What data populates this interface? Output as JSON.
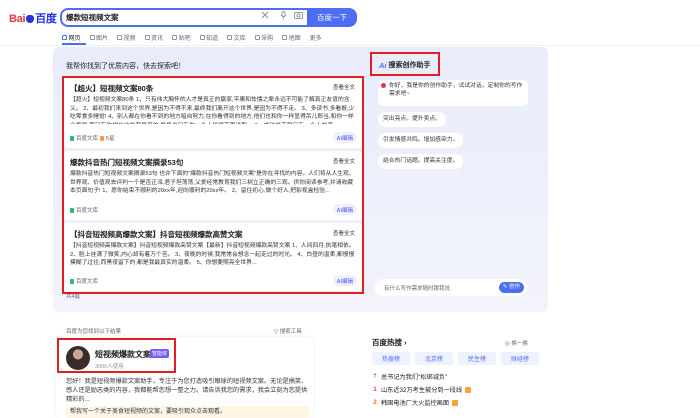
{
  "header": {
    "logo_left": "Bai",
    "logo_right": "百度",
    "search_value": "爆款短视频文案",
    "search_button": "百度一下"
  },
  "tabs": [
    {
      "label": "网页",
      "active": true
    },
    {
      "label": "图片",
      "active": false
    },
    {
      "label": "视频",
      "active": false
    },
    {
      "label": "资讯",
      "active": false
    },
    {
      "label": "贴吧",
      "active": false
    },
    {
      "label": "知道",
      "active": false
    },
    {
      "label": "文库",
      "active": false
    },
    {
      "label": "采购",
      "active": false
    },
    {
      "label": "地图",
      "active": false
    },
    {
      "label": "更多",
      "active": false
    }
  ],
  "main": {
    "intro": "我帮你找到了优质内容，快去探索吧！",
    "cards": [
      {
        "title": "【超火】短视频文案80条",
        "more": "查看全文",
        "body": "【超火】短视频文案80条 1、只有伟大胸怀的人才是真正的赢家,平庸和怯懦之辈永远不可能了解真正友谊的含义。 2、最初我们来到这个世界,是因为不得不来,最终我们离开这个世界,是因为不得不走。 3、多读书,多看报,少吃零食多睡觉! 4、别人都在你看不到的地方暗自努力,在你看得到的地方,他们也和你一样显得吊儿郎当,和你一样会抱怨,而只有你相信这些都是真的,最后也只有你一个人继续不思进取。 3、成功并不是只有一个人的事...",
        "source": "百度文库",
        "source_tag": "5星",
        "ai_edit": "AI编辑"
      },
      {
        "title": "爆款抖音热门短视频文案摘录53句",
        "more": "查看全文",
        "body": "爆款抖音热门短视频文案摘录53句 也许下面的\"爆款抖音热门短视频文案\"是你在寻找的内容。人们将从人生观、世界观、价值观去评判一个是否正派,君子坦荡荡,父爱经常教育我们三树立正确的三观。供你阅读参考,并请收藏本页面句子! 1、愿你结束不顺利的20xx年,迎向顺利的20xx年。 2、留住初心,做个好人,把影视盒检验...",
        "source": "百度文库",
        "source_tag": "",
        "ai_edit": "AI编辑"
      },
      {
        "title": "【抖音短视频高爆款文案】抖音短视频爆款高赞文案",
        "more": "查看全文",
        "body": "【抖音短视频高爆款文案】抖音短视频爆款高赞文案【最新】抖音短视频爆款高赞文案 1、人间四月,执笔相依。 2、脸上挂满了微笑,内心却有着万个苦。 3、夜晚的时候,我常常会想念一起走过的时光。 4、白昼的温柔,都慢慢模糊了过往,而黑夜留下的,都是我最真实的温柔。 5、你想要照亮全世界...",
        "source": "百度文库",
        "source_tag": "",
        "ai_edit": "AI编辑"
      }
    ],
    "count": "共4篇"
  },
  "helper": {
    "title": "搜索创作助手",
    "ai_logo": "Ai",
    "greeting": "你好，我是你的创作助手，试试对话，定制你的写作需求吧~",
    "suggestions": [
      "突出亮点。提升卖点。",
      "引发情感共鸣。增加感染力。",
      "结合热门话题。提高关注度。"
    ],
    "input_placeholder": "有什么写作需求随时跟我说",
    "create_button": "创作"
  },
  "lower": {
    "recommend_text": "百度为您找到以下结果",
    "search_tools": "搜索工具",
    "profile": {
      "name": "短视频爆款文案",
      "badge": "智能体",
      "users": "3000人使用",
      "desc": "您好！我是短视频爆款文案助手，专注于为您打造吸引眼球的短视频文案。无论是搞笑、感人还是励志类的内容，我都能帮您想一整之力。请告诉我您的需求，我会立刻为您提供精彩的...",
      "prompt": "帮我写一个关于美食短视频的文案，要吸引观众点击观看。"
    },
    "hot": {
      "title": "百度热搜",
      "refresh": "换一换",
      "tabs": [
        "热搜榜",
        "北京榜",
        "民生榜",
        "财经榜"
      ],
      "items": [
        {
          "rank": "顶",
          "text": "总书记为我们\"松绑减负\"",
          "flag": ""
        },
        {
          "rank": "1",
          "text": "山东近32万考生被分到一段线",
          "flag": "hot"
        },
        {
          "rank": "2",
          "text": "韩国电池厂大火监控画面",
          "flag": "hot"
        }
      ]
    }
  }
}
